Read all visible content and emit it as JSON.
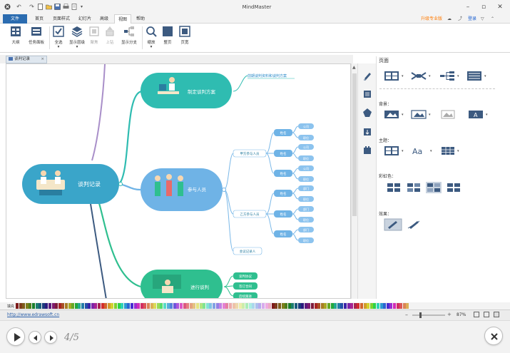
{
  "app": {
    "title": "MindMaster"
  },
  "menus": {
    "file": "文件",
    "home": "首页",
    "page_style": "页面样式",
    "slides": "幻灯片",
    "advanced": "高级",
    "view": "视图",
    "help": "帮助"
  },
  "menu_right": {
    "upgrade": "升级专业版",
    "login": "登录"
  },
  "ribbon": {
    "outline": "大纲",
    "task_panel": "任务面板",
    "select_all": "全选",
    "show_level": "显示层级",
    "focus": "聚焦",
    "up_level": "上钻",
    "show_branch": "显示分支",
    "zoom": "缩放",
    "full_page": "整页",
    "page_width": "页宽"
  },
  "doc_tab": {
    "label": "谈判记录",
    "close": "×"
  },
  "mindmap": {
    "root": "谈判记录",
    "plan": "制定谈判方案",
    "plan_note": "前期谈判资料和谈判方案",
    "participants": "参与人员",
    "side_a": "甲方参与人员",
    "side_b": "乙方参与人员",
    "recorder": "会议记录人",
    "names": [
      "姓名",
      "姓名",
      "姓名",
      "姓名",
      "姓名",
      "姓名"
    ],
    "a_details": [
      "公司",
      "职位",
      "公司",
      "职位",
      "公司",
      "职位"
    ],
    "b_details": [
      "部门",
      "职位",
      "部门",
      "职位",
      "部门",
      "职位"
    ],
    "negotiation": "进行谈判",
    "neg_items": [
      "谈判协议",
      "签订合同",
      "后续跟进"
    ]
  },
  "panel": {
    "title": "页面",
    "background": "背景：",
    "theme": "主题：",
    "rainbow": "彩虹色：",
    "effect": "效果："
  },
  "colorbar": {
    "label": "填充"
  },
  "status": {
    "url": "http://www.edrawsoft.cn",
    "zoom": "87%"
  },
  "player": {
    "page_counter": "4/5"
  },
  "colors": {
    "teal": "#2fbcb1",
    "blue_root": "#3aa5c9",
    "light_blue": "#6fb3e6",
    "green": "#2fbf8f",
    "file_tab": "#2b6cb0",
    "upgrade": "#ff7a00"
  }
}
